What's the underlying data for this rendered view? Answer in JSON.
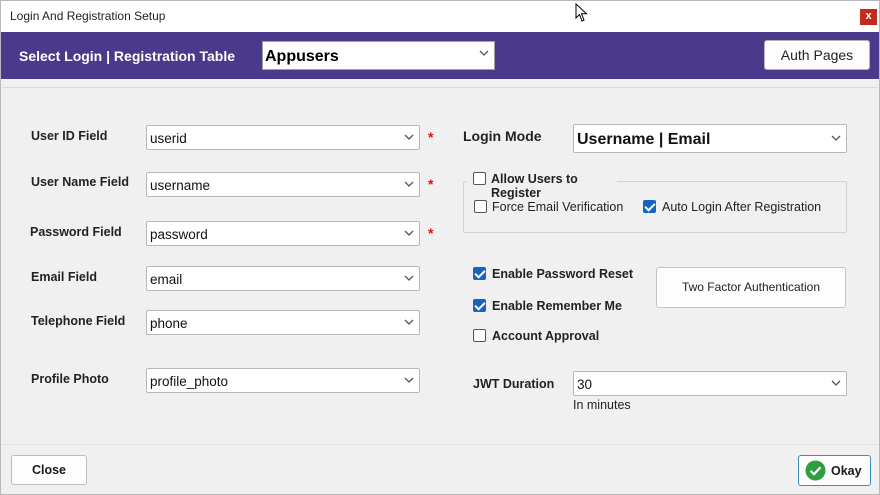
{
  "window": {
    "title": "Login And Registration Setup",
    "close_glyph": "x"
  },
  "header": {
    "label": "Select Login | Registration Table",
    "table_value": "Appusers",
    "auth_pages_label": "Auth Pages"
  },
  "fields": {
    "user_id": {
      "label": "User ID Field",
      "value": "userid",
      "required": "*"
    },
    "user_name": {
      "label": "User Name Field",
      "value": "username",
      "required": "*"
    },
    "password": {
      "label": "Password Field",
      "value": "password",
      "required": "*"
    },
    "email": {
      "label": "Email Field",
      "value": "email"
    },
    "telephone": {
      "label": "Telephone Field",
      "value": "phone"
    },
    "profile_photo": {
      "label": "Profile Photo",
      "value": "profile_photo"
    }
  },
  "login_mode": {
    "label": "Login Mode",
    "value": "Username | Email"
  },
  "registration": {
    "allow_label": "Allow Users to Register",
    "allow_checked": false,
    "force_email_label": "Force Email Verification",
    "force_email_checked": false,
    "auto_login_label": "Auto Login After Registration",
    "auto_login_checked": true
  },
  "options": {
    "password_reset_label": "Enable Password Reset",
    "password_reset_checked": true,
    "remember_me_label": "Enable Remember Me",
    "remember_me_checked": true,
    "account_approval_label": "Account Approval",
    "account_approval_checked": false,
    "two_factor_label": "Two Factor Authentication"
  },
  "jwt": {
    "label": "JWT Duration",
    "value": "30",
    "hint": "In minutes"
  },
  "footer": {
    "close_label": "Close",
    "okay_label": "Okay"
  },
  "colors": {
    "header": "#4b3a8c",
    "checkbox_on": "#1565c0",
    "required": "#dd1111",
    "ok_green": "#2e9e3e"
  }
}
